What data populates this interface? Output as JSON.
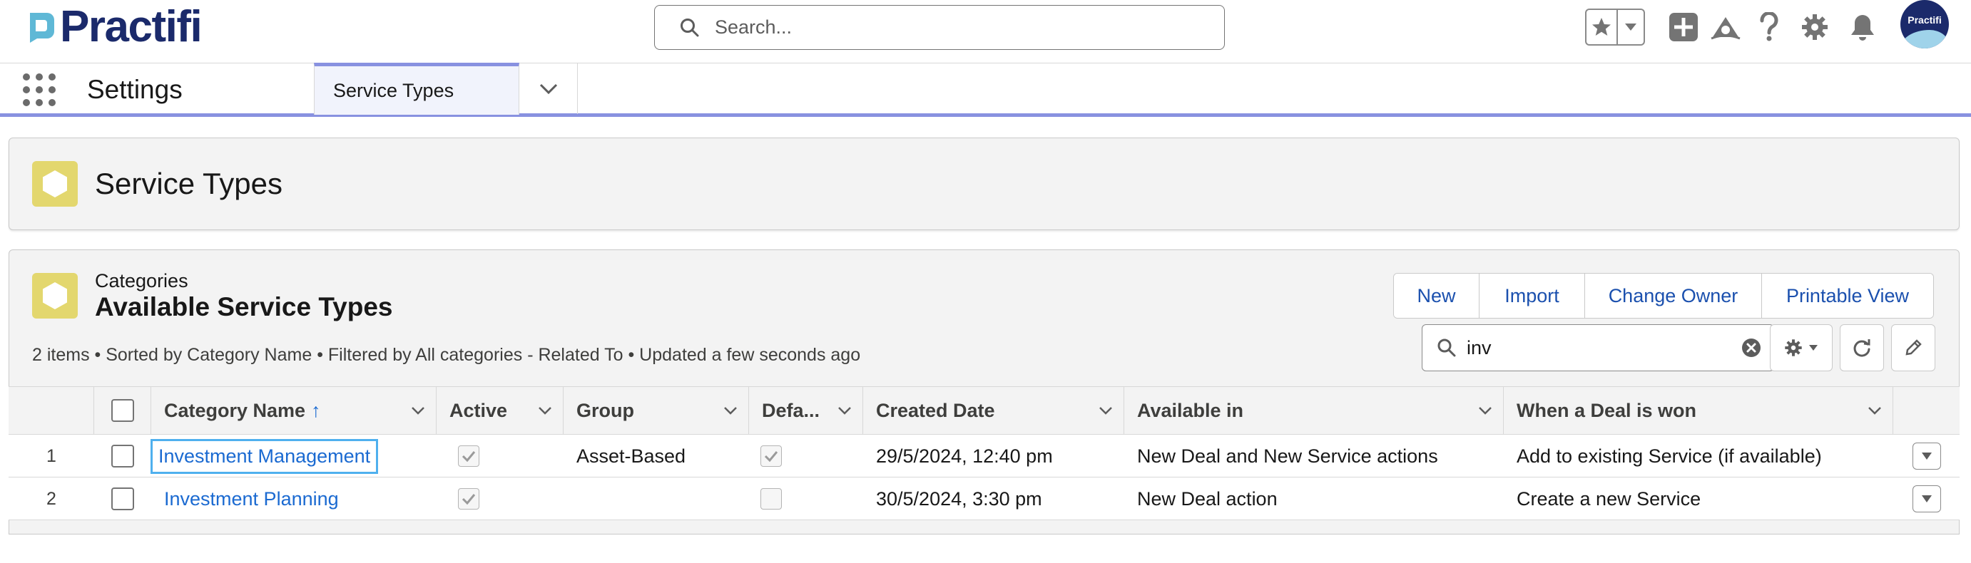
{
  "global_header": {
    "logo_text": "Practifi",
    "search_placeholder": "Search...",
    "avatar_text": "Practifi",
    "icons": [
      "star-icon",
      "chevron-down-icon",
      "add-icon",
      "trailhead-icon",
      "help-icon",
      "setup-gear-icon",
      "notification-bell-icon"
    ]
  },
  "nav": {
    "app_name": "Settings",
    "active_tab": "Service Types"
  },
  "page_header": {
    "title": "Service Types"
  },
  "related_list": {
    "eyebrow": "Categories",
    "title": "Available Service Types",
    "info": "2 items • Sorted by Category Name • Filtered by All categories - Related To • Updated a few seconds ago",
    "buttons": [
      "New",
      "Import",
      "Change Owner",
      "Printable View"
    ],
    "search_value": "inv"
  },
  "table": {
    "columns": [
      "Category Name",
      "Active",
      "Group",
      "Defa...",
      "Created Date",
      "Available in",
      "When a Deal is won"
    ],
    "sort_indicator": "↑",
    "rows": [
      {
        "num": "1",
        "category_name": "Investment Management",
        "active": true,
        "group": "Asset-Based",
        "default": true,
        "created_date": "29/5/2024, 12:40 pm",
        "available_in": "New Deal and New Service actions",
        "when_deal_won": "Add to existing Service (if available)"
      },
      {
        "num": "2",
        "category_name": "Investment Planning",
        "active": true,
        "group": "",
        "default": false,
        "created_date": "30/5/2024, 3:30 pm",
        "available_in": "New Deal action",
        "when_deal_won": "Create a new Service"
      }
    ]
  },
  "colors": {
    "brand_navy": "#1b2a6b",
    "brand_teal": "#5fb8d6",
    "nav_accent": "#8891e0",
    "object_icon": "#e3d76e",
    "link": "#1b6ad1"
  }
}
